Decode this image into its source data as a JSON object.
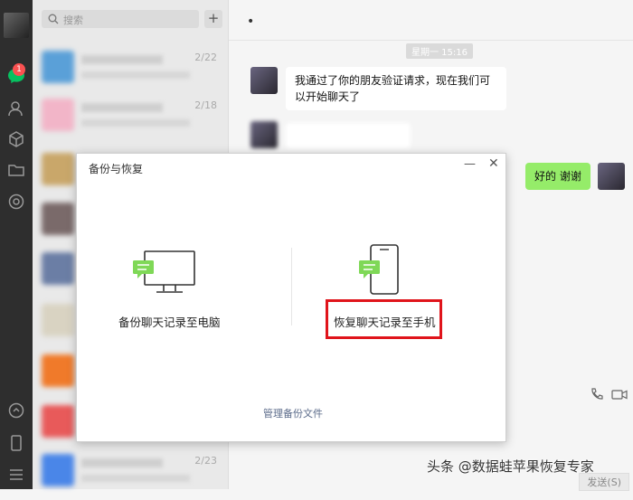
{
  "sidebar": {
    "badge_count": "1"
  },
  "chat_list": {
    "search_placeholder": "搜索",
    "items": [
      {
        "date": "2/22"
      },
      {
        "date": "2/18"
      },
      {
        "date": ""
      },
      {
        "date": ""
      },
      {
        "date": ""
      },
      {
        "date": ""
      },
      {
        "date": ""
      },
      {
        "date": "2/23"
      }
    ]
  },
  "chat": {
    "timestamp": "星期一 15:16",
    "messages": [
      {
        "text": "我通过了你的朋友验证请求，现在我们可以开始聊天了"
      },
      {
        "text": "好的 谢谢"
      }
    ],
    "send_label": "发送(S)"
  },
  "dialog": {
    "title": "备份与恢复",
    "option_backup": "备份聊天记录至电脑",
    "option_restore": "恢复聊天记录至手机",
    "manage_link": "管理备份文件"
  },
  "watermark": "头条 @数据蛙苹果恢复专家",
  "colors": {
    "highlight": "#e0141b",
    "my_bubble": "#95ec69",
    "accent": "#07c160"
  }
}
